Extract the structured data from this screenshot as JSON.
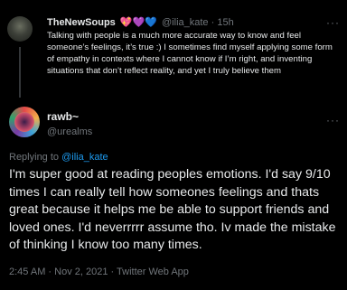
{
  "parent_tweet": {
    "display_name": "TheNewSoups",
    "emoji": "💖💜💙",
    "handle": "@ilia_kate",
    "separator": "·",
    "time": "15h",
    "text": "Talking with people is a much more accurate way to know and feel someone’s feelings, it’s true :) I sometimes find myself applying some form of empathy in contexts where I cannot know if I’m right, and inventing situations that don’t reflect reality, and yet I truly believe them",
    "menu": "···"
  },
  "main_tweet": {
    "display_name": "rawb~",
    "handle": "@urealms",
    "replying_prefix": "Replying to ",
    "replying_to": "@ilia_kate",
    "text": "I'm super good at reading peoples emotions. I'd say 9/10 times I can really tell how someones feelings and thats great because it helps me be able to support friends and loved ones. I'd neverrrrr assume tho. Iv made the mistake of thinking I know too many times.",
    "timestamp": "2:45 AM · Nov 2, 2021 · Twitter Web App",
    "menu": "···"
  },
  "colors": {
    "background": "#000000",
    "text": "#e7e9ea",
    "secondary": "#71767b",
    "link": "#1d9bf0"
  }
}
